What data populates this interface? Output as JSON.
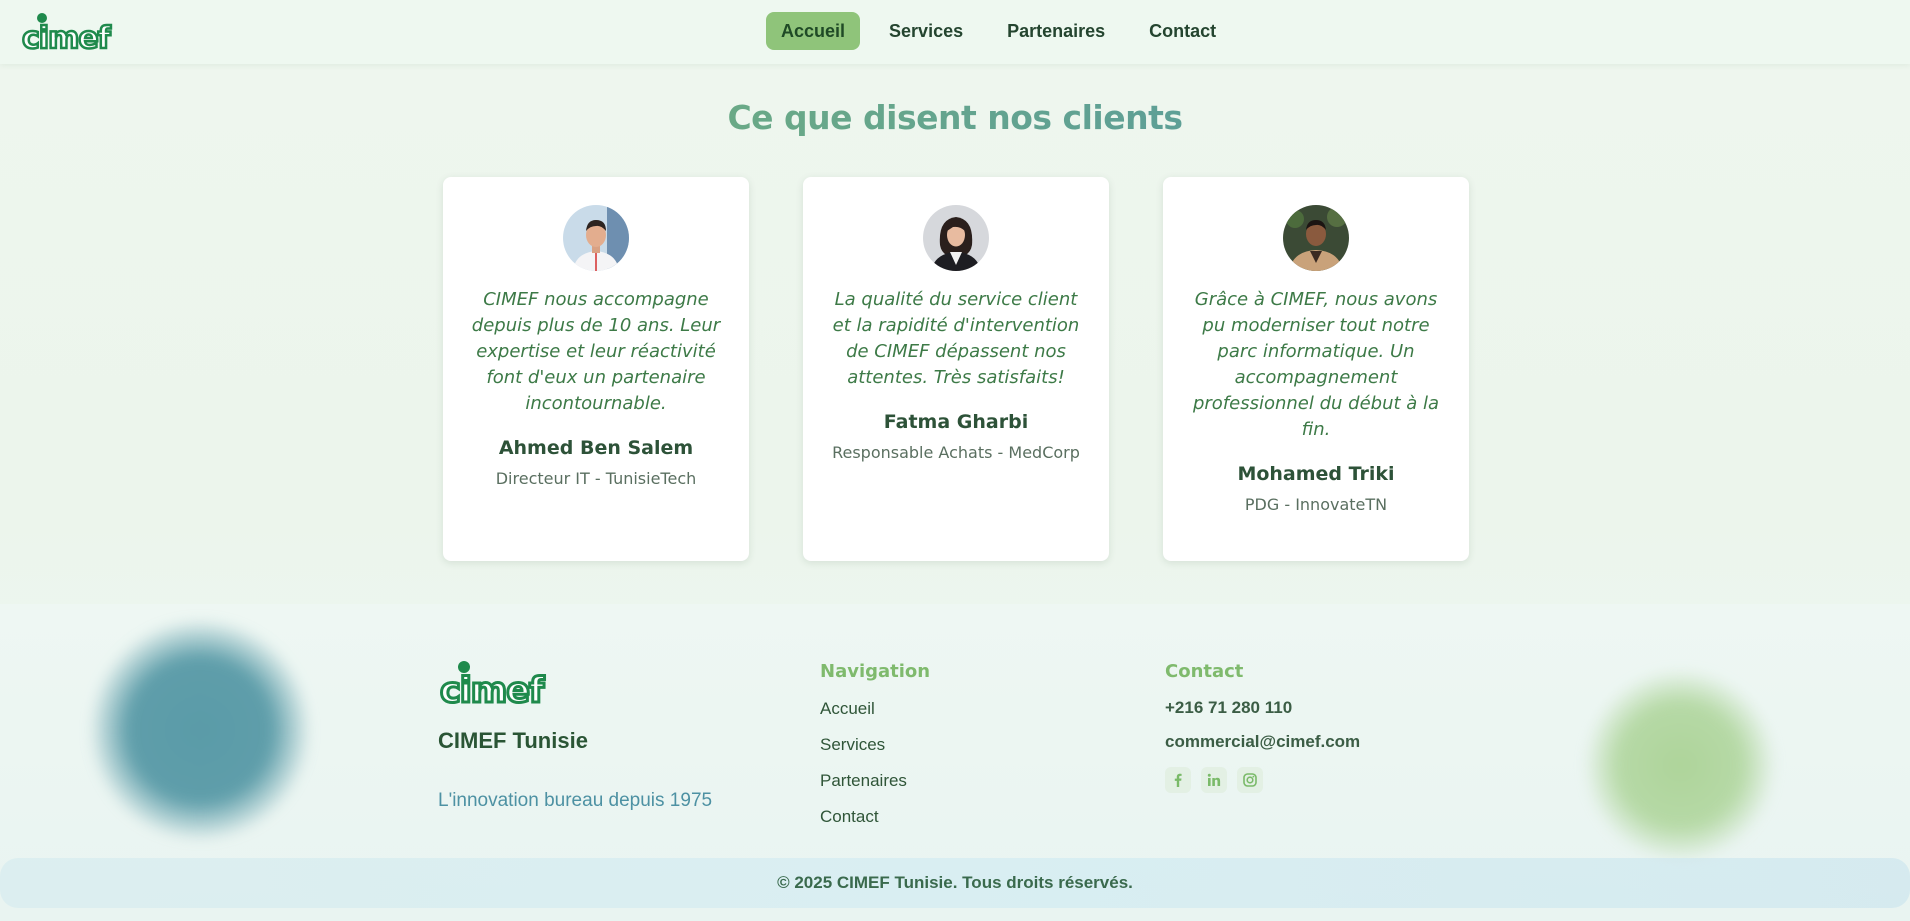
{
  "brand": {
    "logo_text": "cimef",
    "name": "CIMEF Tunisie",
    "tagline": "L'innovation bureau depuis 1975",
    "colors": {
      "primary_green": "#1f8a4c",
      "accent_green": "#8fc47a",
      "teal": "#4f94a8"
    }
  },
  "nav": {
    "items": [
      {
        "label": "Accueil",
        "active": true
      },
      {
        "label": "Services",
        "active": false
      },
      {
        "label": "Partenaires",
        "active": false
      },
      {
        "label": "Contact",
        "active": false
      }
    ]
  },
  "testimonials": {
    "title": "Ce que disent nos clients",
    "items": [
      {
        "quote": "CIMEF nous accompagne depuis plus de 10 ans. Leur expertise et leur réactivité font d'eux un partenaire incontournable.",
        "author": "Ahmed Ben Salem",
        "role": "Directeur IT - TunisieTech",
        "avatar": "man-photo"
      },
      {
        "quote": "La qualité du service client et la rapidité d'intervention de CIMEF dépassent nos attentes. Très satisfaits!",
        "author": "Fatma Gharbi",
        "role": "Responsable Achats - MedCorp",
        "avatar": "woman-photo"
      },
      {
        "quote": "Grâce à CIMEF, nous avons pu moderniser tout notre parc informatique. Un accompagnement professionnel du début à la fin.",
        "author": "Mohamed Triki",
        "role": "PDG - InnovateTN",
        "avatar": "man-photo"
      }
    ]
  },
  "footer": {
    "navigation_title": "Navigation",
    "navigation_links": [
      "Accueil",
      "Services",
      "Partenaires",
      "Contact"
    ],
    "contact_title": "Contact",
    "phone": "+216 71 280 110",
    "email": "commercial@cimef.com",
    "socials": [
      "facebook-icon",
      "linkedin-icon",
      "instagram-icon"
    ],
    "copyright": "© 2025 CIMEF Tunisie. Tous droits réservés."
  }
}
